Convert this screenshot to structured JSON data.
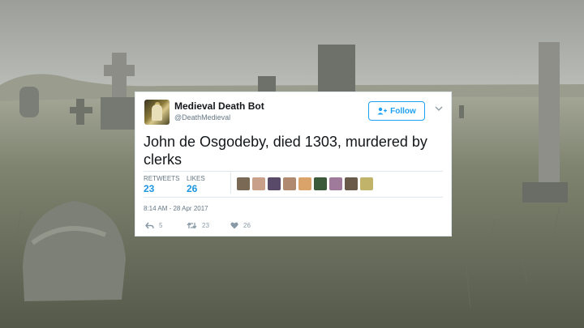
{
  "tweet": {
    "display_name": "Medieval Death Bot",
    "handle": "@DeathMedieval",
    "follow_label": "Follow",
    "text": "John de Osgodeby, died 1303, murdered by clerks",
    "retweets_label": "RETWEETS",
    "retweets_count": "23",
    "likes_label": "LIKES",
    "likes_count": "26",
    "timestamp": "8:14 AM - 28 Apr 2017",
    "reply_count": "5",
    "retweet_action_count": "23",
    "like_action_count": "26",
    "accent_color": "#1da1f2",
    "liker_avatar_colors": [
      "#7a6a55",
      "#c9a08a",
      "#5a4a6a",
      "#b08a70",
      "#d9a36a",
      "#3a5a3a",
      "#a07a9a",
      "#6a5a4a",
      "#c2b36a"
    ]
  },
  "icons": {
    "follow": "add-user-icon",
    "menu": "chevron-down-icon",
    "reply": "reply-icon",
    "retweet": "retweet-icon",
    "like": "heart-icon"
  }
}
